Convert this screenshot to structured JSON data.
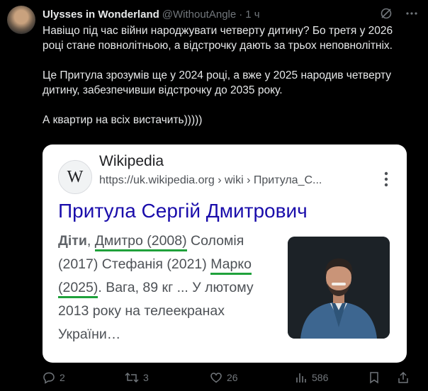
{
  "tweet": {
    "author_name": "Ulysses in Wonderland",
    "handle": "@WithoutAngle",
    "separator": "·",
    "time": "1 ч",
    "paragraphs": [
      "Навіщо під час війни народжувати четверту дитину? Бо третя у 2026 році стане повнолітньою, а відстрочку дають за трьох неповнолітніх.",
      "Це Притула зрозумів ще у 2024 році, а вже у 2025 народив четверту дитину, забезпечивши відстрочку до 2035 року.",
      "А квартир на всіх вистачить)))))"
    ]
  },
  "card": {
    "logo_letter": "W",
    "site_name": "Wikipedia",
    "url": "https://uk.wikipedia.org › wiki › Притула_С...",
    "title": "Притула Сергій Дмитрович",
    "snippet": {
      "label": "Діти",
      "comma": ",",
      "child1": "Дмитро (2008)",
      "mid_text": " Соломія (2017) Стефанія (2021) ",
      "child2": "Марко (2025)",
      "tail": ". Вага, 89 кг ... У лютому 2013 року на телеекранах України…"
    }
  },
  "actions": {
    "replies": "2",
    "reposts": "3",
    "likes": "26",
    "views": "586"
  },
  "colors": {
    "background": "#000000",
    "text": "#e7e9ea",
    "muted": "#71767b",
    "link_title": "#1a0dab",
    "highlight_underline": "#1fa13b"
  }
}
